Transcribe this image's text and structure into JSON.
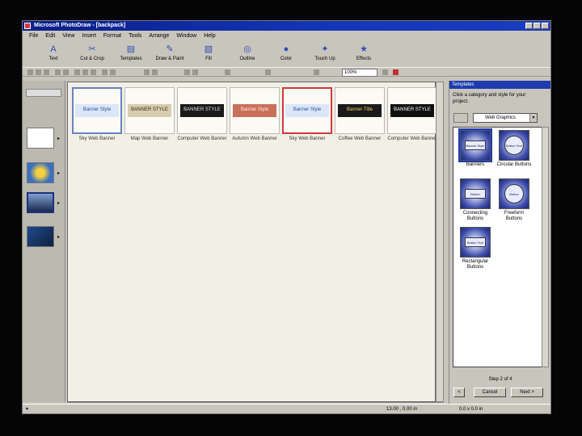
{
  "window": {
    "title": "Microsoft PhotoDraw - [backpack]"
  },
  "menu": [
    "File",
    "Edit",
    "View",
    "Insert",
    "Format",
    "Tools",
    "Arrange",
    "Window",
    "Help"
  ],
  "toolbar": [
    {
      "label": "Text",
      "icon": "text-icon"
    },
    {
      "label": "Cut & Crop",
      "icon": "scissors-icon"
    },
    {
      "label": "Templates",
      "icon": "templates-icon"
    },
    {
      "label": "Draw & Paint",
      "icon": "brush-icon"
    },
    {
      "label": "Fill",
      "icon": "fill-icon"
    },
    {
      "label": "Outline",
      "icon": "outline-icon"
    },
    {
      "label": "Color",
      "icon": "color-icon"
    },
    {
      "label": "Touch Up",
      "icon": "touchup-icon"
    },
    {
      "label": "Effects",
      "icon": "effects-icon"
    }
  ],
  "zoom": "100%",
  "gallery": [
    {
      "label": "Sky Web Banner",
      "art": "Banner Style",
      "bg": "#dbe6f8",
      "fg": "#2a4fa0",
      "state": "hover"
    },
    {
      "label": "Map Web Banner",
      "art": "BANNER STYLE",
      "bg": "#d8ccb0",
      "fg": "#3a2a10",
      "state": ""
    },
    {
      "label": "Computer Web Banner",
      "art": "BANNER STYLE",
      "bg": "#1a1a1a",
      "fg": "#e0e0e0",
      "state": ""
    },
    {
      "label": "Autumn Web Banner",
      "art": "Banner Style",
      "bg": "#c9705a",
      "fg": "#fff0e0",
      "state": ""
    },
    {
      "label": "Sky Web Banner",
      "art": "Banner Style",
      "bg": "#dbe6f8",
      "fg": "#2a4fa0",
      "state": "selected"
    },
    {
      "label": "Coffee Web Banner",
      "art": "Banner Title",
      "bg": "#1a1a1a",
      "fg": "#f0d060",
      "state": ""
    },
    {
      "label": "Computer Web Banner",
      "art": "BANNER STYLE",
      "bg": "#101010",
      "fg": "#ffffff",
      "state": ""
    }
  ],
  "templates": {
    "title": "Templates",
    "instruction": "Click a category and style for your project.",
    "category": "Web Graphics",
    "items": [
      {
        "label": "Banners",
        "art": "Banner Style",
        "shape": "rect"
      },
      {
        "label": "Circular Buttons",
        "art": "Button Text",
        "shape": "round"
      },
      {
        "label": "Connecting Buttons",
        "art": "Button",
        "shape": "rect"
      },
      {
        "label": "Freeform Buttons",
        "art": "Button",
        "shape": "round"
      },
      {
        "label": "Rectangular Buttons",
        "art": "Button Text",
        "shape": "rect"
      }
    ],
    "step": "Step 2 of 4",
    "cancel": "Cancel",
    "next": "Next >",
    "back": "<"
  },
  "status": {
    "coordinates": "13.00 , 0.00 in",
    "size": "0.0 x 0.0 in"
  }
}
